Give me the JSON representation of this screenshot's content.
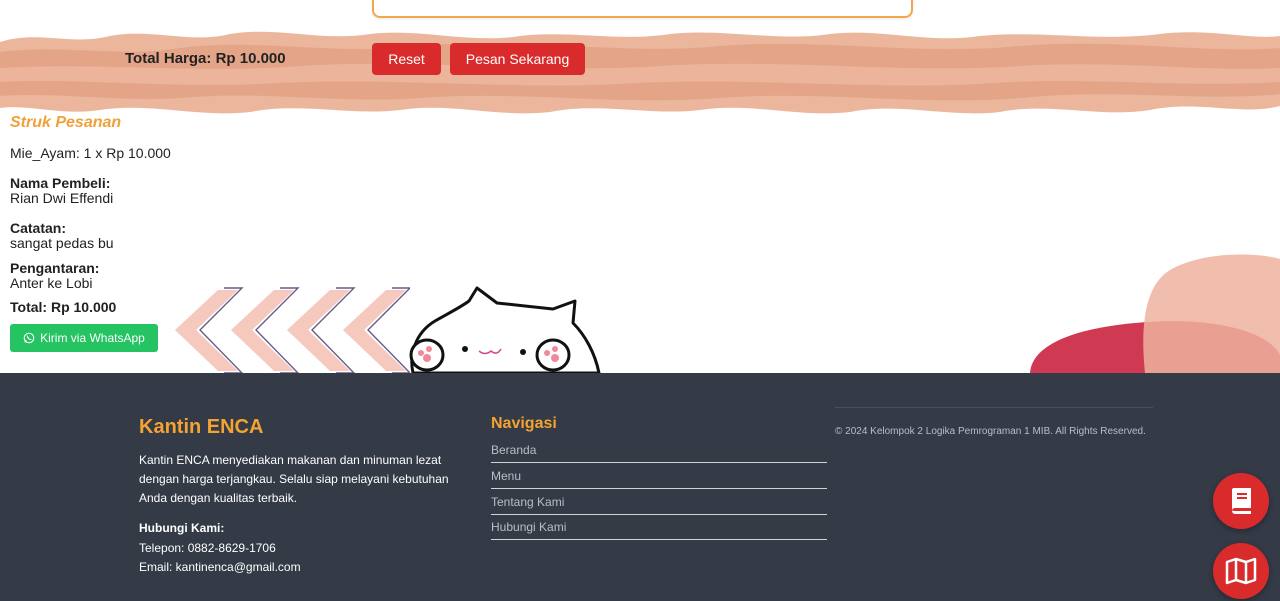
{
  "order": {
    "total_label": "Total Harga: Rp 10.000",
    "reset_label": "Reset",
    "order_label": "Pesan Sekarang"
  },
  "receipt": {
    "title": "Struk Pesanan",
    "item_line": "Mie_Ayam: 1 x Rp 10.000",
    "buyer_label": "Nama Pembeli:",
    "buyer_value": "Rian Dwi Effendi",
    "note_label": "Catatan:",
    "note_value": "sangat pedas bu",
    "delivery_label": "Pengantaran:",
    "delivery_value": "Anter ke Lobi",
    "total": "Total: Rp 10.000",
    "whatsapp_label": "Kirim via WhatsApp"
  },
  "footer": {
    "brand": "Kantin ENCA",
    "description": "Kantin ENCA menyediakan makanan dan minuman lezat dengan harga terjangkau. Selalu siap melayani kebutuhan Anda dengan kualitas terbaik.",
    "contact_label": "Hubungi Kami:",
    "phone": "Telepon: 0882-8629-1706",
    "email": "Email: kantinenca@gmail.com",
    "nav_title": "Navigasi",
    "nav_items": [
      {
        "label": "Beranda"
      },
      {
        "label": "Menu"
      },
      {
        "label": "Tentang Kami"
      },
      {
        "label": "Hubungi Kami"
      }
    ],
    "copyright": "© 2024 Kelompok 2 Logika Pemrograman 1 MIB. All Rights Reserved."
  },
  "colors": {
    "accent_orange": "#f3a331",
    "button_red": "#d92b2b",
    "whatsapp_green": "#25c362",
    "footer_bg": "#343a46",
    "brush_peach": "#e8a98a"
  },
  "icons": {
    "fab_top": "book-icon",
    "fab_bottom": "map-icon",
    "whatsapp": "whatsapp-icon"
  }
}
